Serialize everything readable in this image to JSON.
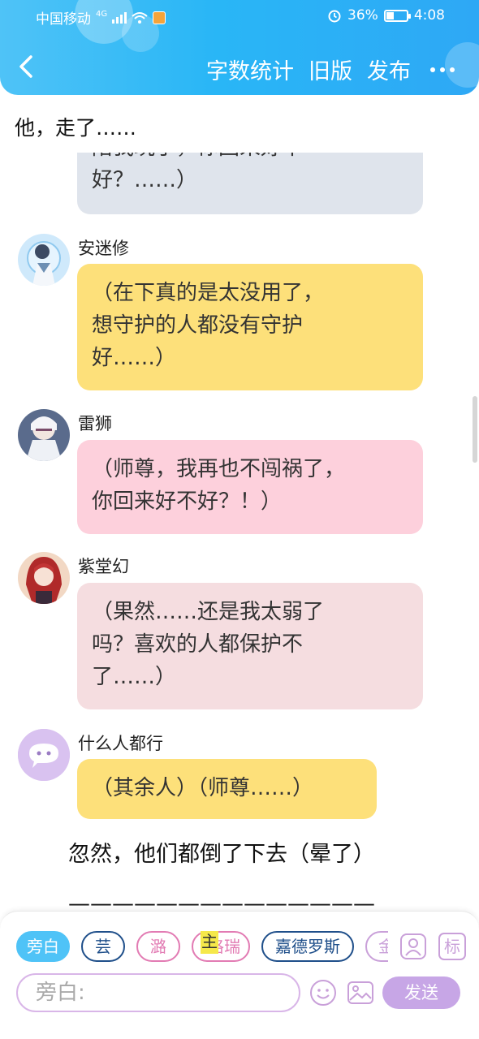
{
  "status": {
    "carrier": "中国移动",
    "network": "4G",
    "battery": "36%",
    "battery_level": 0.36,
    "time": "4:08"
  },
  "header": {
    "word_count": "字数统计",
    "old_version": "旧版",
    "publish": "发布"
  },
  "pinned_text": "他，走了……",
  "partial_message": {
    "line1": "陪我玩了，你回来好不",
    "line2": "好？……）",
    "color": "#dfe4ec"
  },
  "messages": [
    {
      "sender": "安迷修",
      "lines": [
        "（在下真的是太没用了，",
        "想守护的人都没有守护",
        "好……）"
      ],
      "color": "#fde07a"
    },
    {
      "sender": "雷狮",
      "lines": [
        "（师尊，我再也不闯祸了，",
        "你回来好不好？！）"
      ],
      "color": "#fdd0dc"
    },
    {
      "sender": "紫堂幻",
      "lines": [
        "（果然……还是我太弱了",
        "吗？喜欢的人都保护不",
        "了……）"
      ],
      "color": "#f5dde0"
    },
    {
      "sender": "什么人都行",
      "lines": [
        "（其余人）（师尊……）"
      ],
      "color": "#fde07a"
    }
  ],
  "narration": "忽然，他们都倒了下去（晕了）",
  "divider_text": "——————————————",
  "characters": [
    {
      "label": "旁白",
      "active": true
    },
    {
      "label": "芸",
      "active": false
    },
    {
      "label": "潞",
      "active": false
    },
    {
      "label": "格瑞",
      "active": false
    },
    {
      "label": "嘉德罗斯",
      "active": false
    },
    {
      "label": "金",
      "active": false
    }
  ],
  "main_badge": "主",
  "input": {
    "placeholder": "旁白:"
  },
  "send_label": "发送",
  "mark_label": "标"
}
